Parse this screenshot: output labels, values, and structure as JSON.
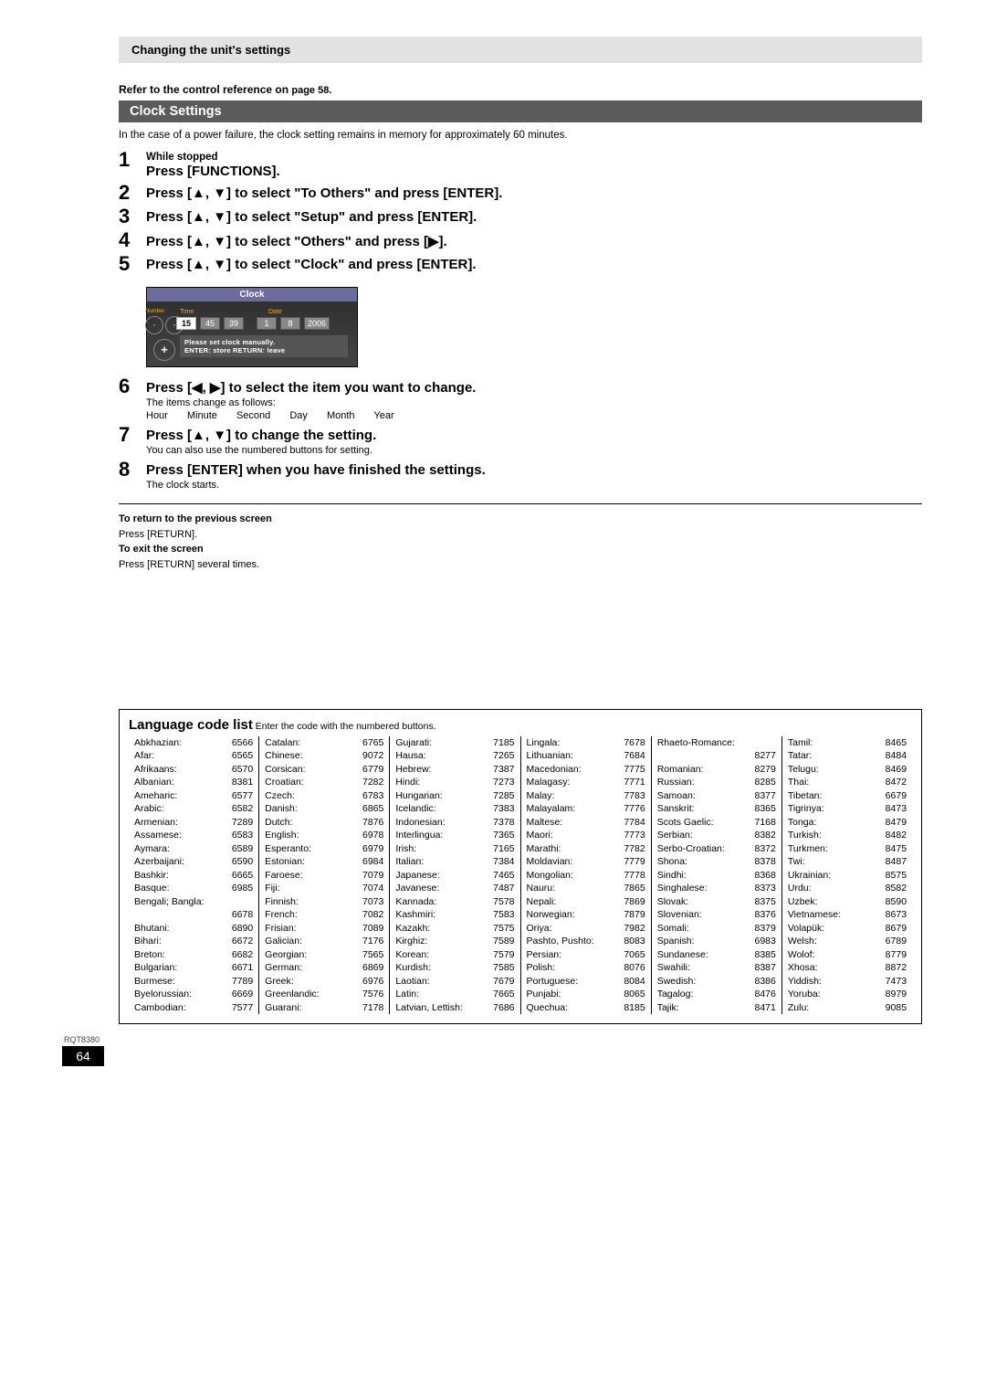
{
  "header": {
    "title": "Changing the unit's settings"
  },
  "ref": {
    "prefix": "Refer to the control reference on ",
    "page": "page 58."
  },
  "section": {
    "title": "Clock Settings"
  },
  "power_note": "In the case of a power failure, the clock setting remains in memory for approximately 60 minutes.",
  "steps": [
    {
      "num": "1",
      "sub": "While stopped",
      "main": "Press [FUNCTIONS]."
    },
    {
      "num": "2",
      "main": "Press [▲, ▼] to select \"To Others\" and press [ENTER]."
    },
    {
      "num": "3",
      "main": "Press [▲, ▼] to select \"Setup\" and press [ENTER]."
    },
    {
      "num": "4",
      "main": "Press [▲, ▼] to select \"Others\" and press [▶]."
    },
    {
      "num": "5",
      "main": "Press [▲, ▼] to select \"Clock\" and press [ENTER]."
    }
  ],
  "clock": {
    "title": "Clock",
    "time_label": "Time",
    "date_label": "Date",
    "nav_label": "Number",
    "hour": "15",
    "minute": "45",
    "second": "39",
    "day": "1",
    "month": "8",
    "year": "2006",
    "msg_line1": "Please set clock manually.",
    "msg_line2": "ENTER: store    RETURN: leave"
  },
  "steps2": [
    {
      "num": "6",
      "main": "Press [◀, ▶] to select the item you want to change.",
      "note1": "The items change as follows:",
      "note2": "Hour Minute Second Day Month Year"
    },
    {
      "num": "7",
      "main": "Press [▲, ▼] to change the setting.",
      "note1": "You can also use the numbered buttons for setting."
    },
    {
      "num": "8",
      "main": "Press [ENTER] when you have finished the settings.",
      "note1": "The clock starts."
    }
  ],
  "returns": {
    "t1": "To return to the previous screen",
    "l1": "Press [RETURN].",
    "t2": "To exit the screen",
    "l2": "Press [RETURN] several times."
  },
  "lang": {
    "title": "Language code list",
    "sub": " Enter the code with the numbered buttons.",
    "cols": [
      [
        [
          "Abkhazian:",
          "6566"
        ],
        [
          "Afar:",
          "6565"
        ],
        [
          "Afrikaans:",
          "6570"
        ],
        [
          "Albanian:",
          "8381"
        ],
        [
          "Ameharic:",
          "6577"
        ],
        [
          "Arabic:",
          "6582"
        ],
        [
          "Armenian:",
          "7289"
        ],
        [
          "Assamese:",
          "6583"
        ],
        [
          "Aymara:",
          "6589"
        ],
        [
          "Azerbaijani:",
          "6590"
        ],
        [
          "Bashkir:",
          "6665"
        ],
        [
          "Basque:",
          "6985"
        ],
        [
          "Bengali; Bangla:",
          ""
        ],
        [
          "",
          "6678"
        ],
        [
          "Bhutani:",
          "6890"
        ],
        [
          "Bihari:",
          "6672"
        ],
        [
          "Breton:",
          "6682"
        ],
        [
          "Bulgarian:",
          "6671"
        ],
        [
          "Burmese:",
          "7789"
        ],
        [
          "Byelorussian:",
          "6669"
        ],
        [
          "Cambodian:",
          "7577"
        ]
      ],
      [
        [
          "Catalan:",
          "6765"
        ],
        [
          "Chinese:",
          "9072"
        ],
        [
          "Corsican:",
          "6779"
        ],
        [
          "Croatian:",
          "7282"
        ],
        [
          "Czech:",
          "6783"
        ],
        [
          "Danish:",
          "6865"
        ],
        [
          "Dutch:",
          "7876"
        ],
        [
          "English:",
          "6978"
        ],
        [
          "Esperanto:",
          "6979"
        ],
        [
          "Estonian:",
          "6984"
        ],
        [
          "Faroese:",
          "7079"
        ],
        [
          "Fiji:",
          "7074"
        ],
        [
          "Finnish:",
          "7073"
        ],
        [
          "French:",
          "7082"
        ],
        [
          "Frisian:",
          "7089"
        ],
        [
          "Galician:",
          "7176"
        ],
        [
          "Georgian:",
          "7565"
        ],
        [
          "German:",
          "6869"
        ],
        [
          "Greek:",
          "6976"
        ],
        [
          "Greenlandic:",
          "7576"
        ],
        [
          "Guarani:",
          "7178"
        ]
      ],
      [
        [
          "Gujarati:",
          "7185"
        ],
        [
          "Hausa:",
          "7265"
        ],
        [
          "Hebrew:",
          "7387"
        ],
        [
          "Hindi:",
          "7273"
        ],
        [
          "Hungarian:",
          "7285"
        ],
        [
          "Icelandic:",
          "7383"
        ],
        [
          "Indonesian:",
          "7378"
        ],
        [
          "Interlingua:",
          "7365"
        ],
        [
          "Irish:",
          "7165"
        ],
        [
          "Italian:",
          "7384"
        ],
        [
          "Japanese:",
          "7465"
        ],
        [
          "Javanese:",
          "7487"
        ],
        [
          "Kannada:",
          "7578"
        ],
        [
          "Kashmiri:",
          "7583"
        ],
        [
          "Kazakh:",
          "7575"
        ],
        [
          "Kirghiz:",
          "7589"
        ],
        [
          "Korean:",
          "7579"
        ],
        [
          "Kurdish:",
          "7585"
        ],
        [
          "Laotian:",
          "7679"
        ],
        [
          "Latin:",
          "7665"
        ],
        [
          "Latvian, Lettish:",
          "7686"
        ]
      ],
      [
        [
          "Lingala:",
          "7678"
        ],
        [
          "Lithuanian:",
          "7684"
        ],
        [
          "Macedonian:",
          "7775"
        ],
        [
          "Malagasy:",
          "7771"
        ],
        [
          "Malay:",
          "7783"
        ],
        [
          "Malayalam:",
          "7776"
        ],
        [
          "Maltese:",
          "7784"
        ],
        [
          "Maori:",
          "7773"
        ],
        [
          "Marathi:",
          "7782"
        ],
        [
          "Moldavian:",
          "7779"
        ],
        [
          "Mongolian:",
          "7778"
        ],
        [
          "Nauru:",
          "7865"
        ],
        [
          "Nepali:",
          "7869"
        ],
        [
          "Norwegian:",
          "7879"
        ],
        [
          "Oriya:",
          "7982"
        ],
        [
          "Pashto, Pushto:",
          "8083"
        ],
        [
          "Persian:",
          "7065"
        ],
        [
          "Polish:",
          "8076"
        ],
        [
          "Portuguese:",
          "8084"
        ],
        [
          "Punjabi:",
          "8065"
        ],
        [
          "Quechua:",
          "8185"
        ]
      ],
      [
        [
          "Rhaeto-Romance:",
          ""
        ],
        [
          "",
          "8277"
        ],
        [
          "Romanian:",
          "8279"
        ],
        [
          "Russian:",
          "8285"
        ],
        [
          "Samoan:",
          "8377"
        ],
        [
          "Sanskrit:",
          "8365"
        ],
        [
          "Scots Gaelic:",
          "7168"
        ],
        [
          "Serbian:",
          "8382"
        ],
        [
          "Serbo-Croatian:",
          "8372"
        ],
        [
          "Shona:",
          "8378"
        ],
        [
          "Sindhi:",
          "8368"
        ],
        [
          "Singhalese:",
          "8373"
        ],
        [
          "Slovak:",
          "8375"
        ],
        [
          "Slovenian:",
          "8376"
        ],
        [
          "Somali:",
          "8379"
        ],
        [
          "Spanish:",
          "6983"
        ],
        [
          "Sundanese:",
          "8385"
        ],
        [
          "Swahili:",
          "8387"
        ],
        [
          "Swedish:",
          "8386"
        ],
        [
          "Tagalog:",
          "8476"
        ],
        [
          "Tajik:",
          "8471"
        ]
      ],
      [
        [
          "Tamil:",
          "8465"
        ],
        [
          "Tatar:",
          "8484"
        ],
        [
          "Telugu:",
          "8469"
        ],
        [
          "Thai:",
          "8472"
        ],
        [
          "Tibetan:",
          "6679"
        ],
        [
          "Tigrinya:",
          "8473"
        ],
        [
          "Tonga:",
          "8479"
        ],
        [
          "Turkish:",
          "8482"
        ],
        [
          "Turkmen:",
          "8475"
        ],
        [
          "Twi:",
          "8487"
        ],
        [
          "Ukrainian:",
          "8575"
        ],
        [
          "Urdu:",
          "8582"
        ],
        [
          "Uzbek:",
          "8590"
        ],
        [
          "Vietnamese:",
          "8673"
        ],
        [
          "Volapük:",
          "8679"
        ],
        [
          "Welsh:",
          "6789"
        ],
        [
          "Wolof:",
          "8779"
        ],
        [
          "Xhosa:",
          "8872"
        ],
        [
          "Yiddish:",
          "7473"
        ],
        [
          "Yoruba:",
          "8979"
        ],
        [
          "Zulu:",
          "9085"
        ]
      ]
    ]
  },
  "footer": {
    "code": "RQT8380",
    "page": "64"
  }
}
